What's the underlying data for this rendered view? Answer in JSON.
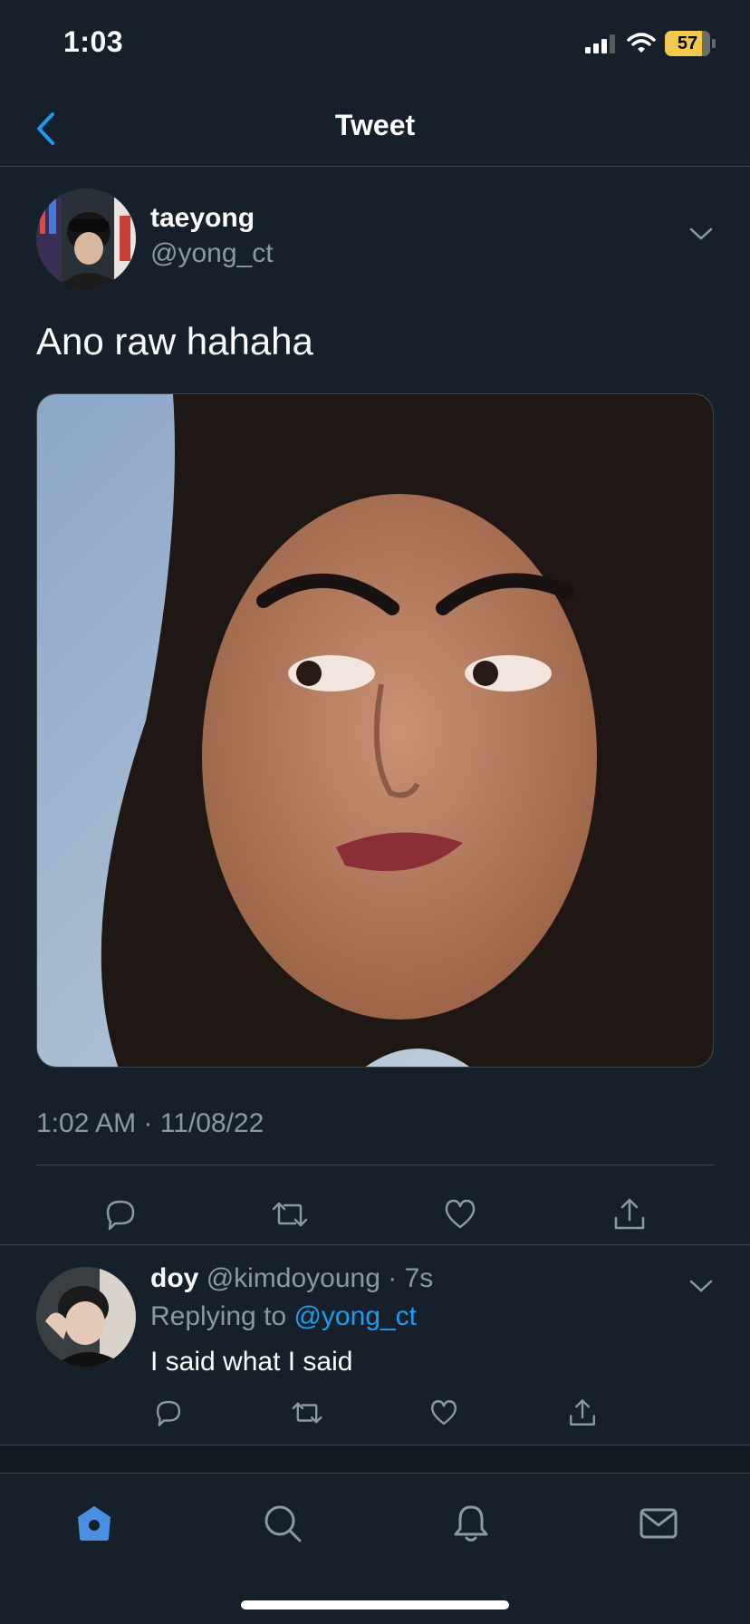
{
  "status_bar": {
    "time": "1:03",
    "battery_level": "57",
    "icons": [
      "cellular-signal-icon",
      "wifi-icon",
      "battery-icon"
    ]
  },
  "nav": {
    "title": "Tweet",
    "back_icon": "chevron-left-icon"
  },
  "tweet": {
    "display_name": "taeyong",
    "handle": "@yong_ct",
    "text": "Ano raw hahaha",
    "timestamp": "1:02 AM · 11/08/22",
    "actions": [
      "reply-icon",
      "retweet-icon",
      "like-icon",
      "share-icon"
    ]
  },
  "reply": {
    "display_name": "doy",
    "handle": "@kimdoyoung",
    "time_ago": " · 7s",
    "replying_prefix": "Replying to ",
    "replying_to": "@yong_ct",
    "text": "I said what I said",
    "actions": [
      "reply-icon",
      "retweet-icon",
      "like-icon",
      "share-icon"
    ]
  },
  "tab_bar": {
    "tabs": [
      "home-icon",
      "search-icon",
      "notifications-icon",
      "messages-icon"
    ],
    "active": "home-icon"
  },
  "colors": {
    "background": "#15202b",
    "accent": "#1d9bf0",
    "secondary_text": "#8b98a5",
    "divider": "#38444d",
    "tab_active": "#4a90e2"
  }
}
